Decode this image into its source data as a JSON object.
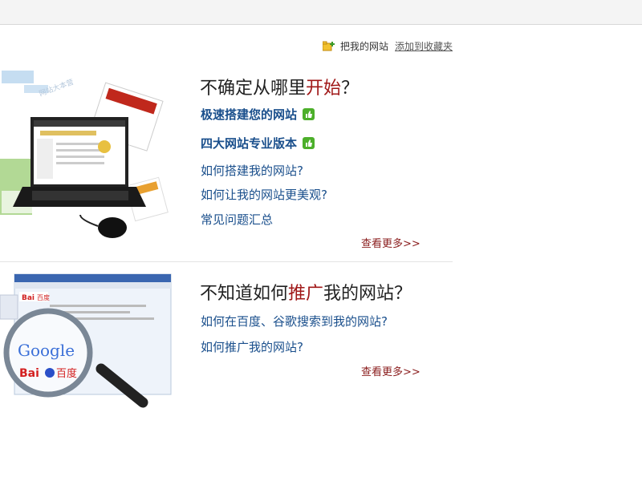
{
  "favorite": {
    "label": "把我的网站",
    "link": "添加到收藏夹"
  },
  "section1": {
    "heading_pre": "不确定从哪里",
    "heading_hl": "开始",
    "heading_post": "？",
    "bold_links": [
      "极速搭建您的网站",
      "四大网站专业版本"
    ],
    "links": [
      "如何搭建我的网站?",
      "如何让我的网站更美观?",
      "常见问题汇总"
    ],
    "more": "查看更多>>"
  },
  "section2": {
    "heading_pre": "不知道如何",
    "heading_hl": "推广",
    "heading_post": "我的网站？",
    "links": [
      "如何在百度、谷歌搜索到我的网站?",
      "如何推广我的网站?"
    ],
    "more": "查看更多>>"
  },
  "illustration2": {
    "google_text": "Google",
    "baidu_text": "Bai",
    "baidu_cn": "百度"
  },
  "colors": {
    "link": "#1a4f8c",
    "highlight": "#a01818",
    "more": "#8a1c1c",
    "thumb_badge": "#4caf2a"
  }
}
